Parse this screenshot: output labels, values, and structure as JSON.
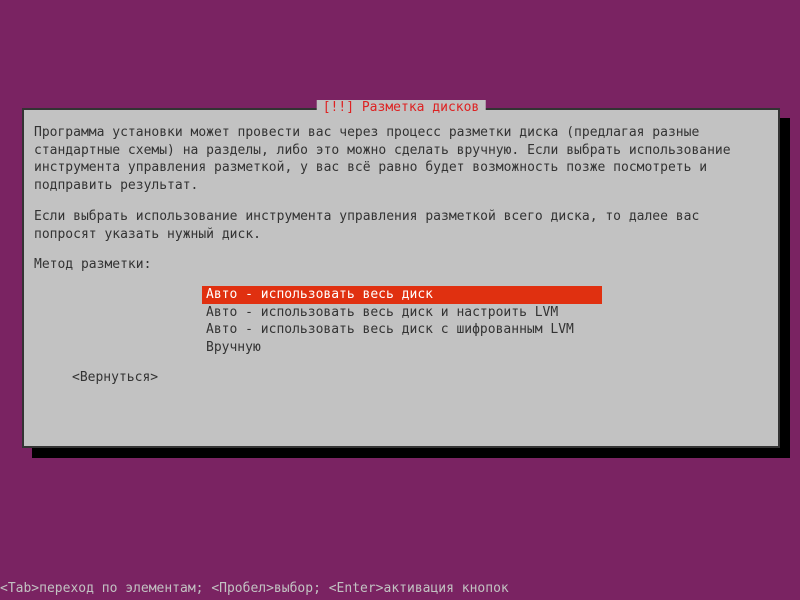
{
  "dialog": {
    "title": "[!!] Разметка дисков",
    "paragraph1": "Программа установки может провести вас через процесс разметки диска (предлагая разные стандартные схемы) на разделы, либо это можно сделать вручную. Если выбрать использование инструмента управления разметкой, у вас всё равно будет возможность позже посмотреть и подправить результат.",
    "paragraph2": "Если выбрать использование инструмента управления разметкой всего диска, то далее вас попросят указать нужный диск.",
    "method_label": "Метод разметки:",
    "menu": {
      "items": [
        {
          "label": "Авто - использовать весь диск",
          "selected": true
        },
        {
          "label": "Авто - использовать весь диск и настроить LVM",
          "selected": false
        },
        {
          "label": "Авто - использовать весь диск с шифрованным LVM",
          "selected": false
        },
        {
          "label": "Вручную",
          "selected": false
        }
      ]
    },
    "back_button": "<Вернуться>"
  },
  "status_bar": "<Tab>переход по элементам; <Пробел>выбор; <Enter>активация кнопок",
  "colors": {
    "background": "#7a2362",
    "panel": "#c2c2c2",
    "highlight": "#e03010",
    "title": "#d22"
  }
}
